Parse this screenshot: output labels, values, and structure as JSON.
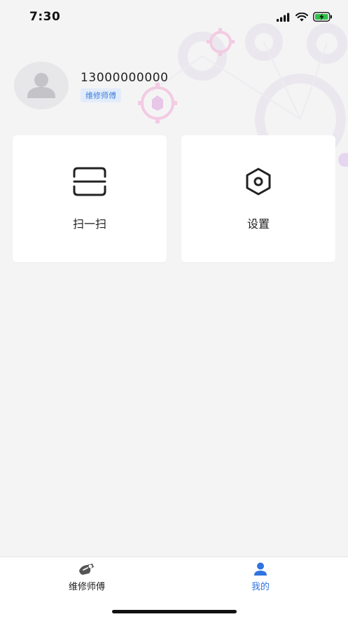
{
  "status_bar": {
    "time": "7:30",
    "icons": [
      "signal-icon",
      "wifi-icon",
      "battery-charging-icon"
    ]
  },
  "profile": {
    "phone": "13000000000",
    "role": "维修师傅",
    "avatar_icon": "user-avatar-icon"
  },
  "cards": [
    {
      "label": "扫一扫",
      "icon": "scan-icon"
    },
    {
      "label": "设置",
      "icon": "settings-hex-icon"
    }
  ],
  "tab_bar": {
    "tabs": [
      {
        "label": "维修师傅",
        "icon": "repair-icon",
        "active": false
      },
      {
        "label": "我的",
        "icon": "person-icon",
        "active": true
      }
    ]
  },
  "colors": {
    "accent": "#2f73e0",
    "badge_bg": "#e3ecfa",
    "background": "#f4f4f5"
  }
}
